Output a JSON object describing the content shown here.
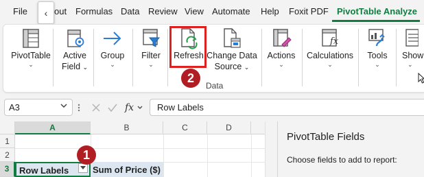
{
  "tabs": [
    {
      "label": "File"
    },
    {
      "label": "out"
    },
    {
      "label": "Formulas"
    },
    {
      "label": "Data"
    },
    {
      "label": "Review"
    },
    {
      "label": "View"
    },
    {
      "label": "Automate"
    },
    {
      "label": "Help"
    },
    {
      "label": "Foxit PDF"
    },
    {
      "label": "PivotTable Analyze"
    }
  ],
  "active_tab": "PivotTable Analyze",
  "tab_scroll_glyph": "‹",
  "ribbon": {
    "pivottable": {
      "label": "PivotTable",
      "icon": "pivottable-icon"
    },
    "active_field": {
      "line1": "Active",
      "line2": "Field",
      "icon": "active-field-icon"
    },
    "group": {
      "label": "Group",
      "icon": "arrow-right-icon"
    },
    "filter": {
      "label": "Filter",
      "icon": "filter-icon"
    },
    "refresh": {
      "label": "Refresh",
      "icon": "refresh-icon"
    },
    "change_data_source": {
      "line1": "Change Data",
      "line2": "Source",
      "icon": "change-data-source-icon"
    },
    "actions": {
      "label": "Actions",
      "icon": "actions-icon"
    },
    "calculations": {
      "label": "Calculations",
      "icon": "calculations-icon"
    },
    "tools": {
      "label": "Tools",
      "icon": "tools-icon"
    },
    "show": {
      "label": "Show",
      "icon": "show-icon"
    },
    "data_group_label": "Data",
    "dropdown_glyph": "⌄"
  },
  "callouts": [
    {
      "number": "1"
    },
    {
      "number": "2"
    }
  ],
  "formula_bar": {
    "name_box": "A3",
    "fx_label": "fx",
    "content": "Row Labels"
  },
  "sheet": {
    "columns": [
      "A",
      "B",
      "C",
      "D"
    ],
    "rows": [
      "1",
      "2",
      "3"
    ],
    "selected_cell": "A3",
    "cells": {
      "A3": "Row Labels",
      "B3": "Sum of Price ($)"
    }
  },
  "task_pane": {
    "title": "PivotTable Fields",
    "subtitle": "Choose fields to add to report:"
  },
  "colors": {
    "accent": "#107c41",
    "callout_red": "#b01e23",
    "highlight_box": "#e0201e",
    "pivot_header_fill": "#dce6f1"
  }
}
